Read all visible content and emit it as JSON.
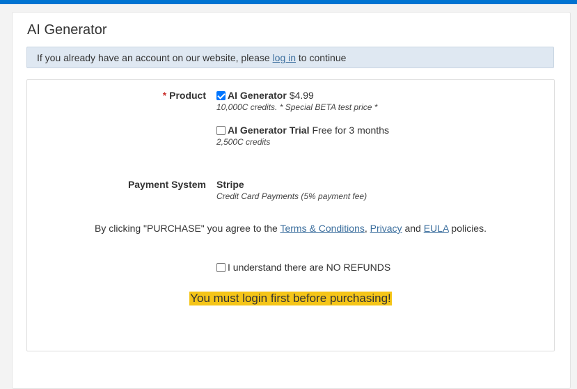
{
  "page": {
    "title": "AI Generator"
  },
  "notice": {
    "prefix": "If you already have an account on our website, please ",
    "link": "log in",
    "suffix": " to continue"
  },
  "product": {
    "required_mark": "*",
    "label": "Product",
    "options": [
      {
        "name": "AI Generator",
        "price": "$4.99",
        "description": "10,000C credits. * Special BETA test price *",
        "checked": true
      },
      {
        "name": "AI Generator Trial",
        "price": "Free for 3 months",
        "description": "2,500C credits",
        "checked": false
      }
    ]
  },
  "payment": {
    "label": "Payment System",
    "name": "Stripe",
    "description": "Credit Card Payments (5% payment fee)"
  },
  "agreement": {
    "prefix": "By clicking \"PURCHASE\" you agree to the ",
    "terms": "Terms & Conditions",
    "sep1": ",",
    "privacy": "Privacy",
    "and": " and ",
    "eula": "EULA",
    "suffix": " policies."
  },
  "refund": {
    "label": "I understand there are NO REFUNDS",
    "checked": false
  },
  "warning": {
    "text": "You must login first before purchasing!"
  },
  "colors": {
    "accent": "#0073d1",
    "link": "#3c6f9e",
    "warning_bg": "#f5c518",
    "notice_bg": "#dfe8f2"
  }
}
